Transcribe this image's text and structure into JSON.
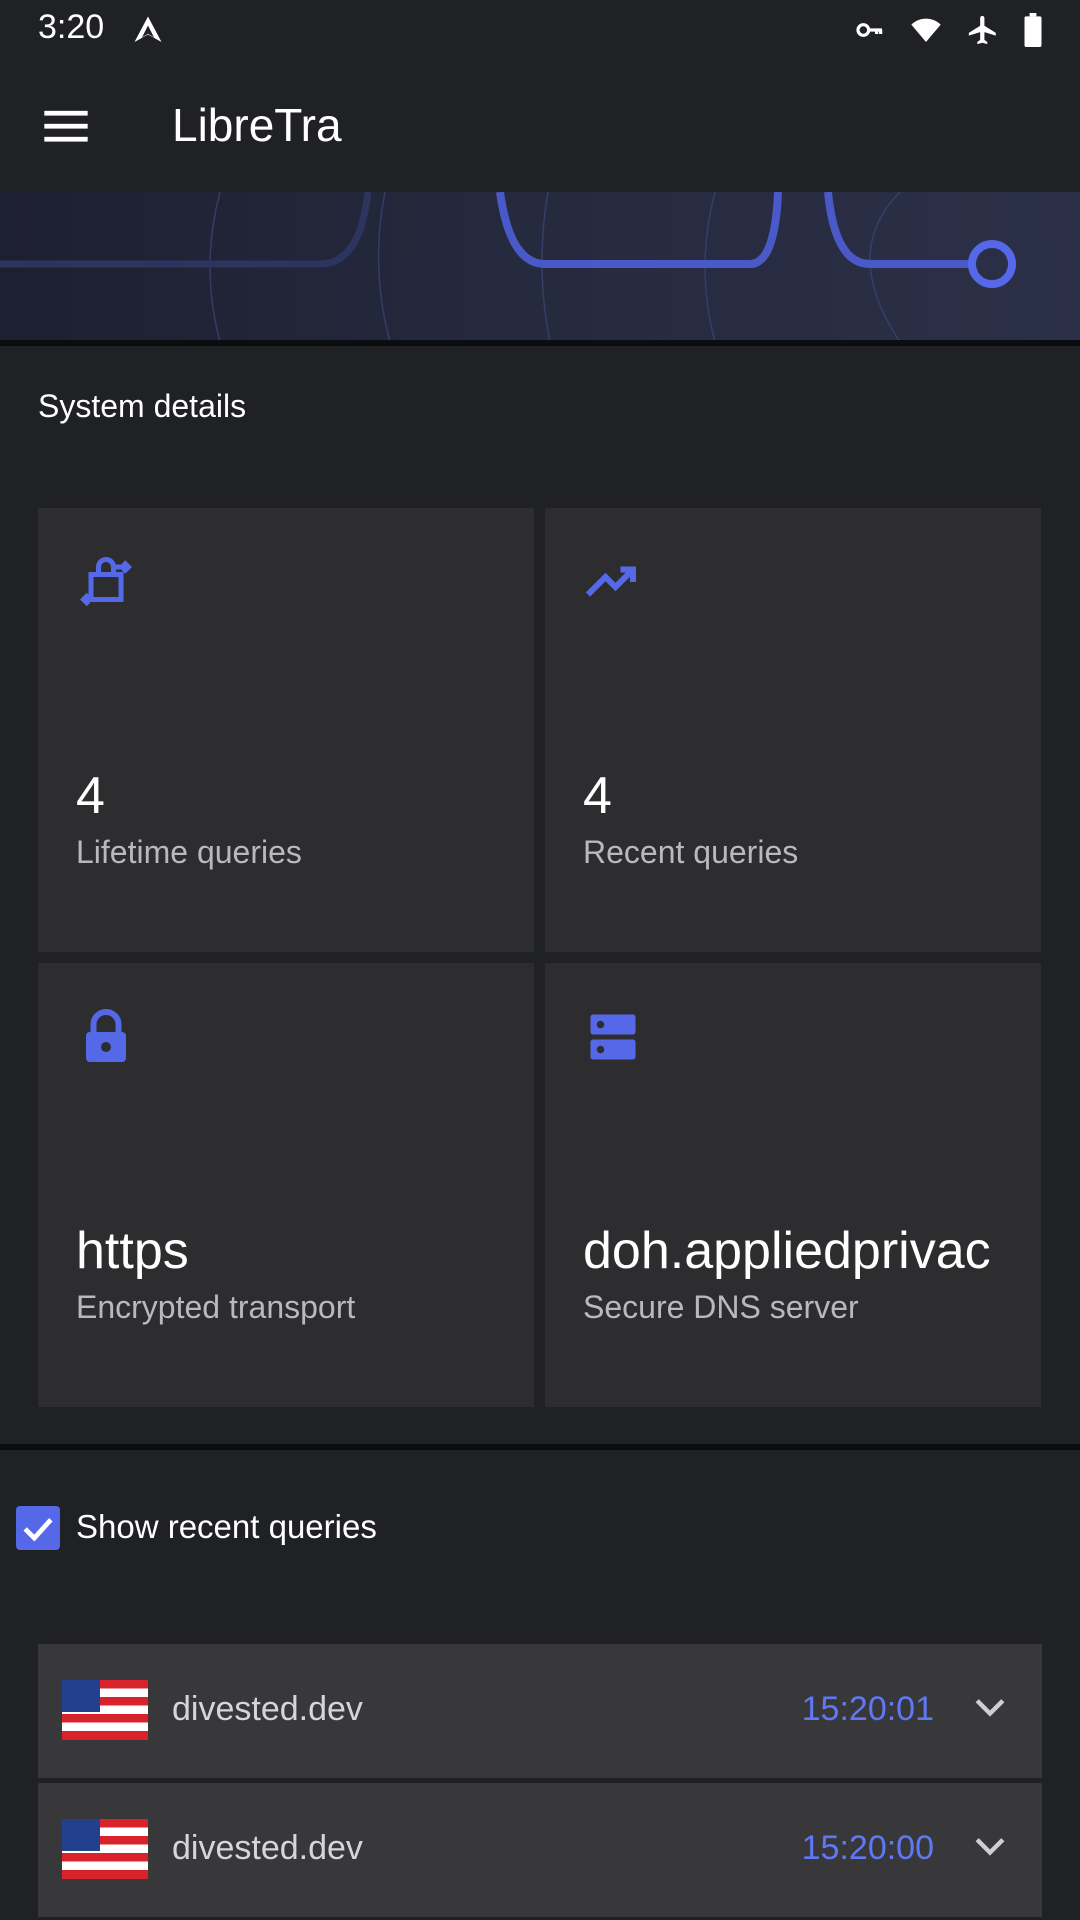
{
  "status_bar": {
    "time": "3:20"
  },
  "app_bar": {
    "title": "LibreTra"
  },
  "system_details": {
    "heading": "System details",
    "cards": [
      {
        "value": "4",
        "label": "Lifetime queries",
        "icon": "lock-transfer-icon"
      },
      {
        "value": "4",
        "label": "Recent queries",
        "icon": "trending-up-icon"
      },
      {
        "value": "https",
        "label": "Encrypted transport",
        "icon": "lock-icon"
      },
      {
        "value": "doh.appliedprivac",
        "label": "Secure DNS server",
        "icon": "dns-server-icon"
      }
    ]
  },
  "recent_queries": {
    "toggle_label": "Show recent queries",
    "checked": true,
    "items": [
      {
        "domain": "divested.dev",
        "time": "15:20:01",
        "flag": "us-flag-icon"
      },
      {
        "domain": "divested.dev",
        "time": "15:20:00",
        "flag": "us-flag-icon"
      }
    ]
  },
  "colors": {
    "accent": "#5468e8",
    "background": "#202125",
    "card": "#2d2d2f",
    "time_text": "#5f78f5"
  }
}
